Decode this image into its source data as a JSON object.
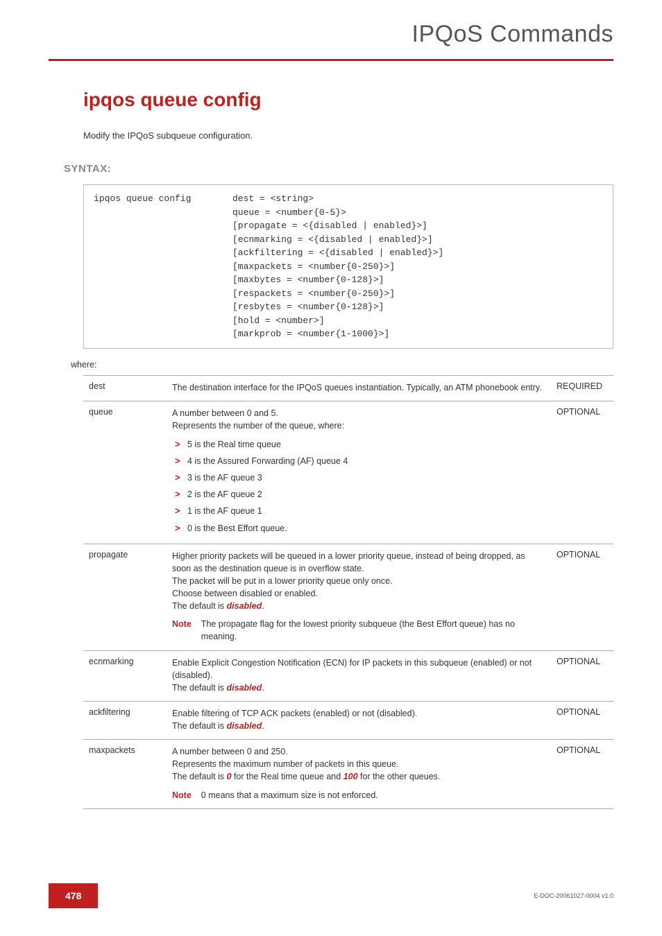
{
  "header": {
    "section": "IPQoS Commands"
  },
  "title": "ipqos queue config",
  "intro": "Modify the IPQoS subqueue configuration.",
  "syntax_label": "SYNTAX:",
  "code": {
    "cmd": "ipqos queue config",
    "args": "dest = <string>\nqueue = <number{0-5}>\n[propagate = <{disabled | enabled}>]\n[ecnmarking = <{disabled | enabled}>]\n[ackfiltering = <{disabled | enabled}>]\n[maxpackets = <number{0-250}>]\n[maxbytes = <number{0-128}>]\n[respackets = <number{0-250}>]\n[resbytes = <number{0-128}>]\n[hold = <number>]\n[markprob = <number{1-1000}>]"
  },
  "where_label": "where:",
  "params": {
    "dest": {
      "name": "dest",
      "desc": "The destination interface for the IPQoS queues instantiation. Typically, an ATM phonebook entry.",
      "req": "REQUIRED"
    },
    "queue": {
      "name": "queue",
      "desc_intro1": "A number between 0 and 5.",
      "desc_intro2": "Represents the number of the queue, where:",
      "items": [
        "5 is the Real time queue",
        "4 is the Assured Forwarding (AF) queue 4",
        "3 is the AF queue 3",
        "2 is the AF queue 2",
        "1 is the AF queue 1",
        "0 is the Best Effort queue."
      ],
      "req": "OPTIONAL"
    },
    "propagate": {
      "name": "propagate",
      "desc1": "Higher priority packets will be queued in a lower priority queue, instead of being dropped, as soon as the destination queue is in overflow state.",
      "desc2": "The packet will be put in a lower priority queue only once.",
      "desc3": "Choose between disabled or enabled.",
      "desc4_prefix": "The default is ",
      "desc4_emph": "disabled",
      "desc4_suffix": ".",
      "note_label": "Note",
      "note_text": "The propagate flag for the lowest priority subqueue (the Best Effort queue) has no meaning.",
      "req": "OPTIONAL"
    },
    "ecnmarking": {
      "name": "ecnmarking",
      "desc1": "Enable Explicit Congestion Notification (ECN) for IP packets in this subqueue (enabled) or not (disabled).",
      "desc2_prefix": "The default is ",
      "desc2_emph": "disabled",
      "desc2_suffix": ".",
      "req": "OPTIONAL"
    },
    "ackfiltering": {
      "name": "ackfiltering",
      "desc1": "Enable filtering of TCP ACK packets (enabled) or not (disabled).",
      "desc2_prefix": "The default is ",
      "desc2_emph": "disabled",
      "desc2_suffix": ".",
      "req": "OPTIONAL"
    },
    "maxpackets": {
      "name": "maxpackets",
      "desc1": "A number between 0 and 250.",
      "desc2": "Represents the maximum number of packets in this queue.",
      "desc3_prefix": "The default is ",
      "desc3_emph1": "0",
      "desc3_mid": " for the Real time queue and ",
      "desc3_emph2": "100",
      "desc3_suffix": " for the other queues.",
      "note_label": "Note",
      "note_text": "0 means that a maximum size is not enforced.",
      "req": "OPTIONAL"
    }
  },
  "footer": {
    "page": "478",
    "docid": "E-DOC-20061027-0004 v1.0"
  }
}
